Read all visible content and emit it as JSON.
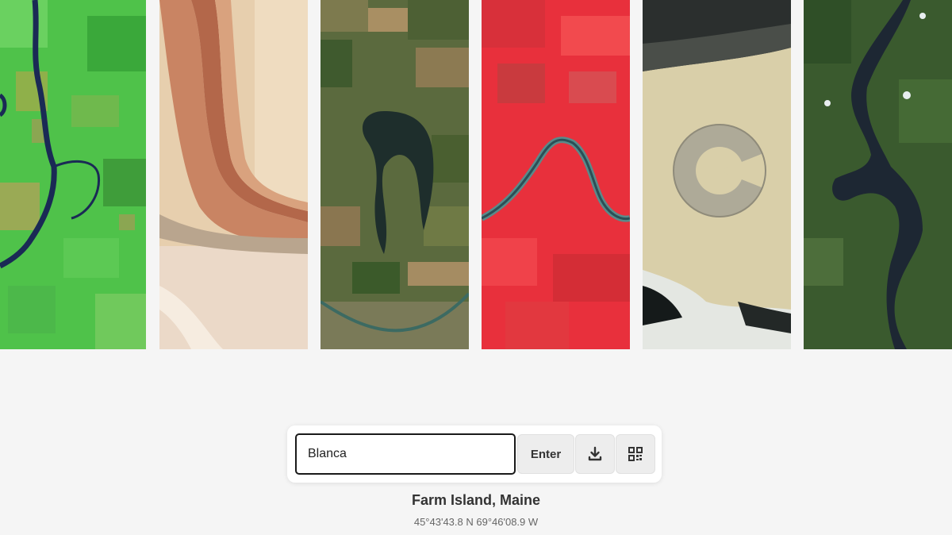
{
  "gallery": {
    "strips": [
      {
        "icon": "river-farmland-green-image"
      },
      {
        "icon": "desert-ridge-image"
      },
      {
        "icon": "oxbow-river-farmland-image"
      },
      {
        "icon": "false-color-red-river-image"
      },
      {
        "icon": "desert-city-arc-image"
      },
      {
        "icon": "forest-lake-image"
      }
    ]
  },
  "search": {
    "value": "Blanca",
    "enter_label": "Enter",
    "download_icon": "download-icon",
    "qr_icon": "qr-code-icon"
  },
  "location": {
    "title": "Farm Island, Maine",
    "coordinates": "45°43'43.8 N 69°46'08.9 W"
  },
  "colors": {
    "background": "#f5f5f5",
    "input_border": "#1a1a1a",
    "button_bg": "#ededed"
  }
}
